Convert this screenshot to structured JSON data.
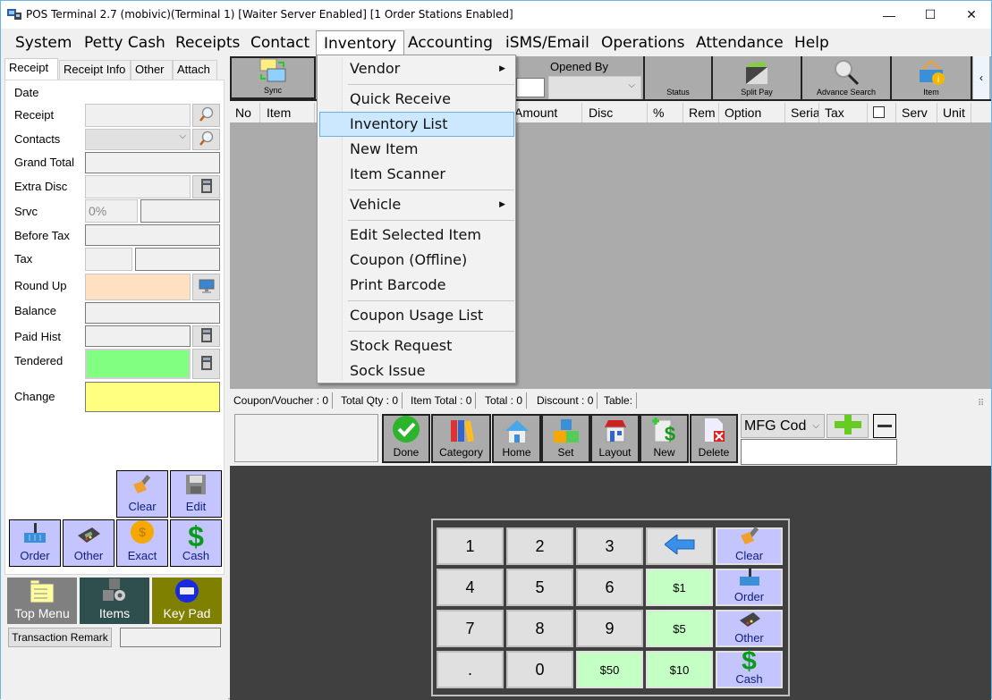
{
  "window": {
    "title": "POS Terminal 2.7 (mobivic)(Terminal 1) [Waiter Server Enabled] [1 Order Stations Enabled]",
    "minimize": "—",
    "maximize": "☐",
    "close": "✕"
  },
  "menubar": [
    "System",
    "Petty Cash",
    "Receipts",
    "Contact",
    "Inventory",
    "Accounting",
    "iSMS/Email",
    "Operations",
    "Attendance",
    "Help"
  ],
  "inventory_menu": {
    "items": [
      {
        "label": "Vendor",
        "submenu": true
      },
      {
        "label": "Quick Receive"
      },
      {
        "label": "Inventory List",
        "highlighted": true
      },
      {
        "label": "New Item"
      },
      {
        "label": "Item Scanner"
      },
      {
        "label": "Vehicle",
        "submenu": true
      },
      {
        "label": "Edit Selected Item"
      },
      {
        "label": "Coupon (Offline)"
      },
      {
        "label": "Print Barcode"
      },
      {
        "label": "Coupon Usage List"
      },
      {
        "label": "Stock Request"
      },
      {
        "label": "Sock Issue"
      }
    ],
    "arrow": "▶"
  },
  "left_tabs": [
    "Receipt",
    "Receipt Info",
    "Other",
    "Attach"
  ],
  "receipt_form": {
    "date": "Date",
    "receipt": "Receipt",
    "contacts": "Contacts",
    "grand_total": "Grand Total",
    "extra_disc": "Extra Disc",
    "srvc": "Srvc",
    "srvc_value": "0%",
    "before_tax": "Before Tax",
    "tax": "Tax",
    "round_up": "Round Up",
    "balance": "Balance",
    "paid_hist": "Paid Hist",
    "tendered": "Tendered",
    "change": "Change"
  },
  "colors": {
    "round_up": "#ffe0c0",
    "tendered": "#80ff80",
    "change": "#ffff80",
    "payment_button": "#c4c4ff",
    "money_key": "#c4ffc4",
    "top_menu_btn": "#808080",
    "items_btn": "#2f4f4f",
    "keypad_btn": "#808000",
    "menu_highlight": "#cce8ff"
  },
  "payment_buttons": {
    "clear": "Clear",
    "edit": "Edit",
    "order": "Order",
    "other": "Other",
    "exact": "Exact",
    "cash": "Cash"
  },
  "nav_buttons": {
    "top_menu": "Top Menu",
    "items": "Items",
    "key_pad": "Key Pad"
  },
  "transaction_remark": "Transaction Remark",
  "toolbar": {
    "sync": "Sync",
    "opened_by": "Opened By",
    "status": "Status",
    "split_pay": "Split Pay",
    "advance_search": "Advance Search",
    "item": "Item",
    "collapse": "‹"
  },
  "grid_columns": [
    "No",
    "Item",
    "Amount",
    "Disc",
    "%",
    "Rem",
    "Option",
    "Seria",
    "Tax",
    "",
    "Serv",
    "Unit"
  ],
  "status_line": {
    "coupon": "Coupon/Voucher :  0",
    "total_qty": "Total Qty :  0",
    "item_total": "Item Total :  0",
    "total": "Total :  0",
    "discount": "Discount :  0",
    "table": "Table:"
  },
  "action_buttons": [
    "Done",
    "Category",
    "Home",
    "Set",
    "Layout",
    "New",
    "Delete"
  ],
  "search_mode": "MFG Cod",
  "keypad": {
    "keys": [
      "1",
      "2",
      "3",
      "4",
      "5",
      "6",
      "7",
      "8",
      "9",
      ".",
      "0"
    ],
    "money": [
      "$1",
      "$5",
      "$50",
      "$10"
    ],
    "actions": [
      "Clear",
      "Order",
      "Other",
      "Cash"
    ]
  }
}
